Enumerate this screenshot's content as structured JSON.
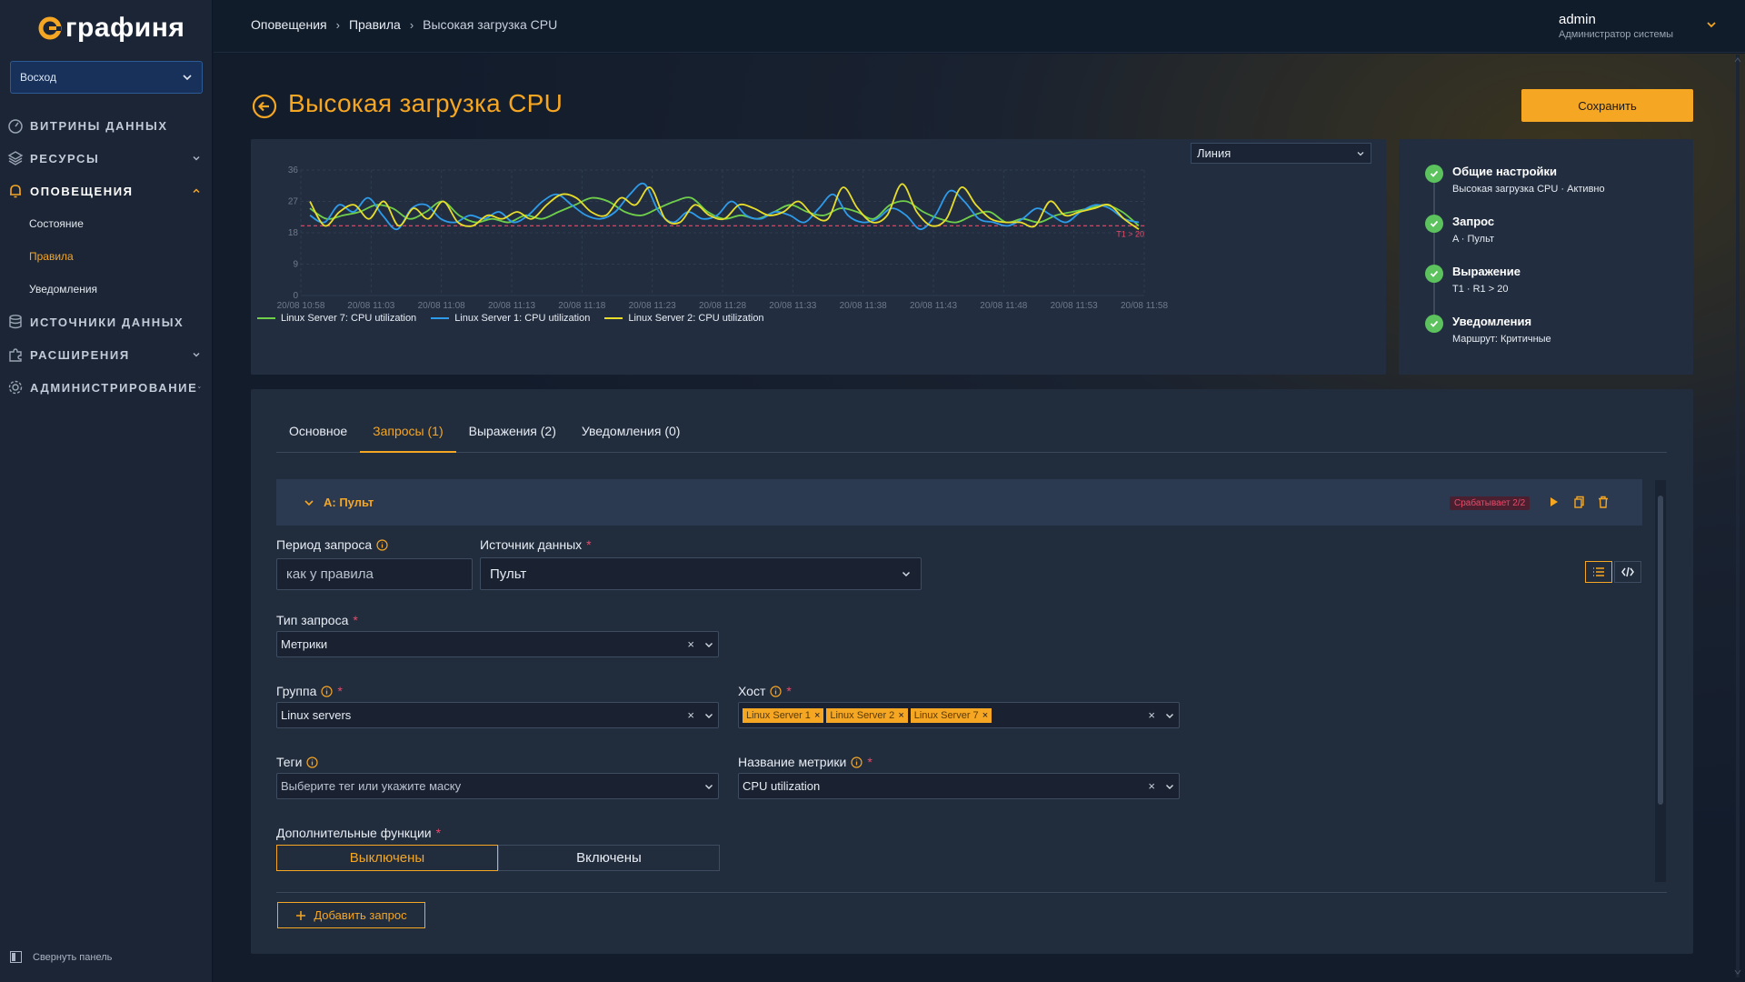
{
  "app": {
    "logo_text": "графиня"
  },
  "sidebar": {
    "org": "Восход",
    "items": [
      {
        "label": "ВИТРИНЫ ДАННЫХ",
        "icon": "dashboard-icon"
      },
      {
        "label": "РЕСУРСЫ",
        "icon": "layers-icon"
      },
      {
        "label": "ОПОВЕЩЕНИЯ",
        "icon": "bell-icon"
      },
      {
        "label": "ИСТОЧНИКИ ДАННЫХ",
        "icon": "database-icon"
      },
      {
        "label": "РАСШИРЕНИЯ",
        "icon": "puzzle-icon"
      },
      {
        "label": "АДМИНИСТРИРОВАНИЕ",
        "icon": "gear-icon"
      }
    ],
    "alerts_sub": [
      "Состояние",
      "Правила",
      "Уведомления"
    ],
    "collapse_label": "Свернуть панель"
  },
  "topbar": {
    "breadcrumb": [
      "Оповещения",
      "Правила",
      "Высокая загрузка CPU"
    ],
    "user_name": "admin",
    "user_role": "Администратор системы"
  },
  "page": {
    "title": "Высокая загрузка CPU",
    "save_label": "Сохранить"
  },
  "chart_panel": {
    "type_select": "Линия"
  },
  "chart_data": {
    "type": "line",
    "title": "",
    "xlabel": "",
    "ylabel": "",
    "ylim": [
      0,
      36
    ],
    "yticks": [
      0,
      9,
      18,
      27,
      36
    ],
    "x": [
      "20/08 10:58",
      "20/08 11:03",
      "20/08 11:08",
      "20/08 11:13",
      "20/08 11:18",
      "20/08 11:23",
      "20/08 11:28",
      "20/08 11:33",
      "20/08 11:38",
      "20/08 11:43",
      "20/08 11:48",
      "20/08 11:53",
      "20/08 11:58"
    ],
    "threshold": {
      "value": 20,
      "label": "T1 > 20",
      "color": "#e84b6a"
    },
    "grid": true,
    "legend_position": "bottom-left",
    "series": [
      {
        "name": "Linux Server 7: CPU utilization",
        "color": "#6fcf4a",
        "values": [
          25,
          22,
          23,
          24,
          26,
          25,
          22,
          24,
          27,
          23,
          21,
          22,
          21,
          23,
          22,
          24,
          26,
          28,
          27,
          24,
          23,
          25,
          27,
          28,
          24,
          22,
          23,
          22,
          24,
          26,
          24,
          23,
          25,
          24,
          22,
          26,
          27,
          24,
          22,
          21,
          23,
          24,
          21,
          22,
          21,
          23,
          24,
          25,
          26,
          24,
          20
        ]
      },
      {
        "name": "Linux Server 1: CPU utilization",
        "color": "#2e9bea",
        "values": [
          23,
          21,
          26,
          24,
          28,
          23,
          19,
          25,
          26,
          22,
          21,
          23,
          22,
          24,
          21,
          23,
          27,
          29,
          26,
          23,
          22,
          24,
          29,
          32,
          24,
          21,
          24,
          22,
          23,
          27,
          23,
          22,
          24,
          23,
          21,
          25,
          29,
          23,
          21,
          22,
          25,
          23,
          19,
          23,
          30,
          27,
          22,
          21,
          20,
          22,
          25,
          23,
          21,
          24,
          26,
          25,
          22,
          21
        ]
      },
      {
        "name": "Linux Server 2: CPU utilization",
        "color": "#e8dd2a",
        "values": [
          27,
          20,
          24,
          26,
          22,
          27,
          20,
          25,
          22,
          27,
          21,
          20,
          23,
          22,
          24,
          22,
          26,
          29,
          28,
          24,
          23,
          28,
          26,
          31,
          22,
          21,
          26,
          23,
          22,
          26,
          25,
          23,
          24,
          27,
          23,
          22,
          31,
          25,
          21,
          23,
          32,
          24,
          20,
          22,
          31,
          26,
          22,
          21,
          21,
          20,
          27,
          23,
          24,
          25,
          26,
          22,
          19
        ]
      }
    ]
  },
  "steps": [
    {
      "title": "Общие настройки",
      "sub": "Высокая загрузка CPU · Активно"
    },
    {
      "title": "Запрос",
      "sub": "A · Пульт"
    },
    {
      "title": "Выражение",
      "sub": "T1 · R1 > 20"
    },
    {
      "title": "Уведомления",
      "sub": "Маршрут: Критичные"
    }
  ],
  "tabs": [
    "Основное",
    "Запросы (1)",
    "Выражения (2)",
    "Уведомления (0)"
  ],
  "query": {
    "title": "A: Пульт",
    "fires_badge": "Срабатывает 2/2",
    "period_label": "Период запроса",
    "period_placeholder": "как у правила",
    "datasource_label": "Источник данных",
    "datasource_value": "Пульт",
    "type_label": "Тип запроса",
    "type_value": "Метрики",
    "group_label": "Группа",
    "group_value": "Linux servers",
    "host_label": "Хост",
    "hosts": [
      "Linux Server 1",
      "Linux Server 2",
      "Linux Server 7"
    ],
    "tags_label": "Теги",
    "tags_placeholder": "Выберите тег или укажите маску",
    "metric_label": "Название метрики",
    "metric_value": "CPU utilization",
    "functions_label": "Дополнительные функции",
    "functions_off": "Выключены",
    "functions_on": "Включены",
    "add_query": "Добавить запрос"
  },
  "colors": {
    "accent": "#f5a623",
    "success": "#5cc25d",
    "danger": "#e84b6a"
  }
}
